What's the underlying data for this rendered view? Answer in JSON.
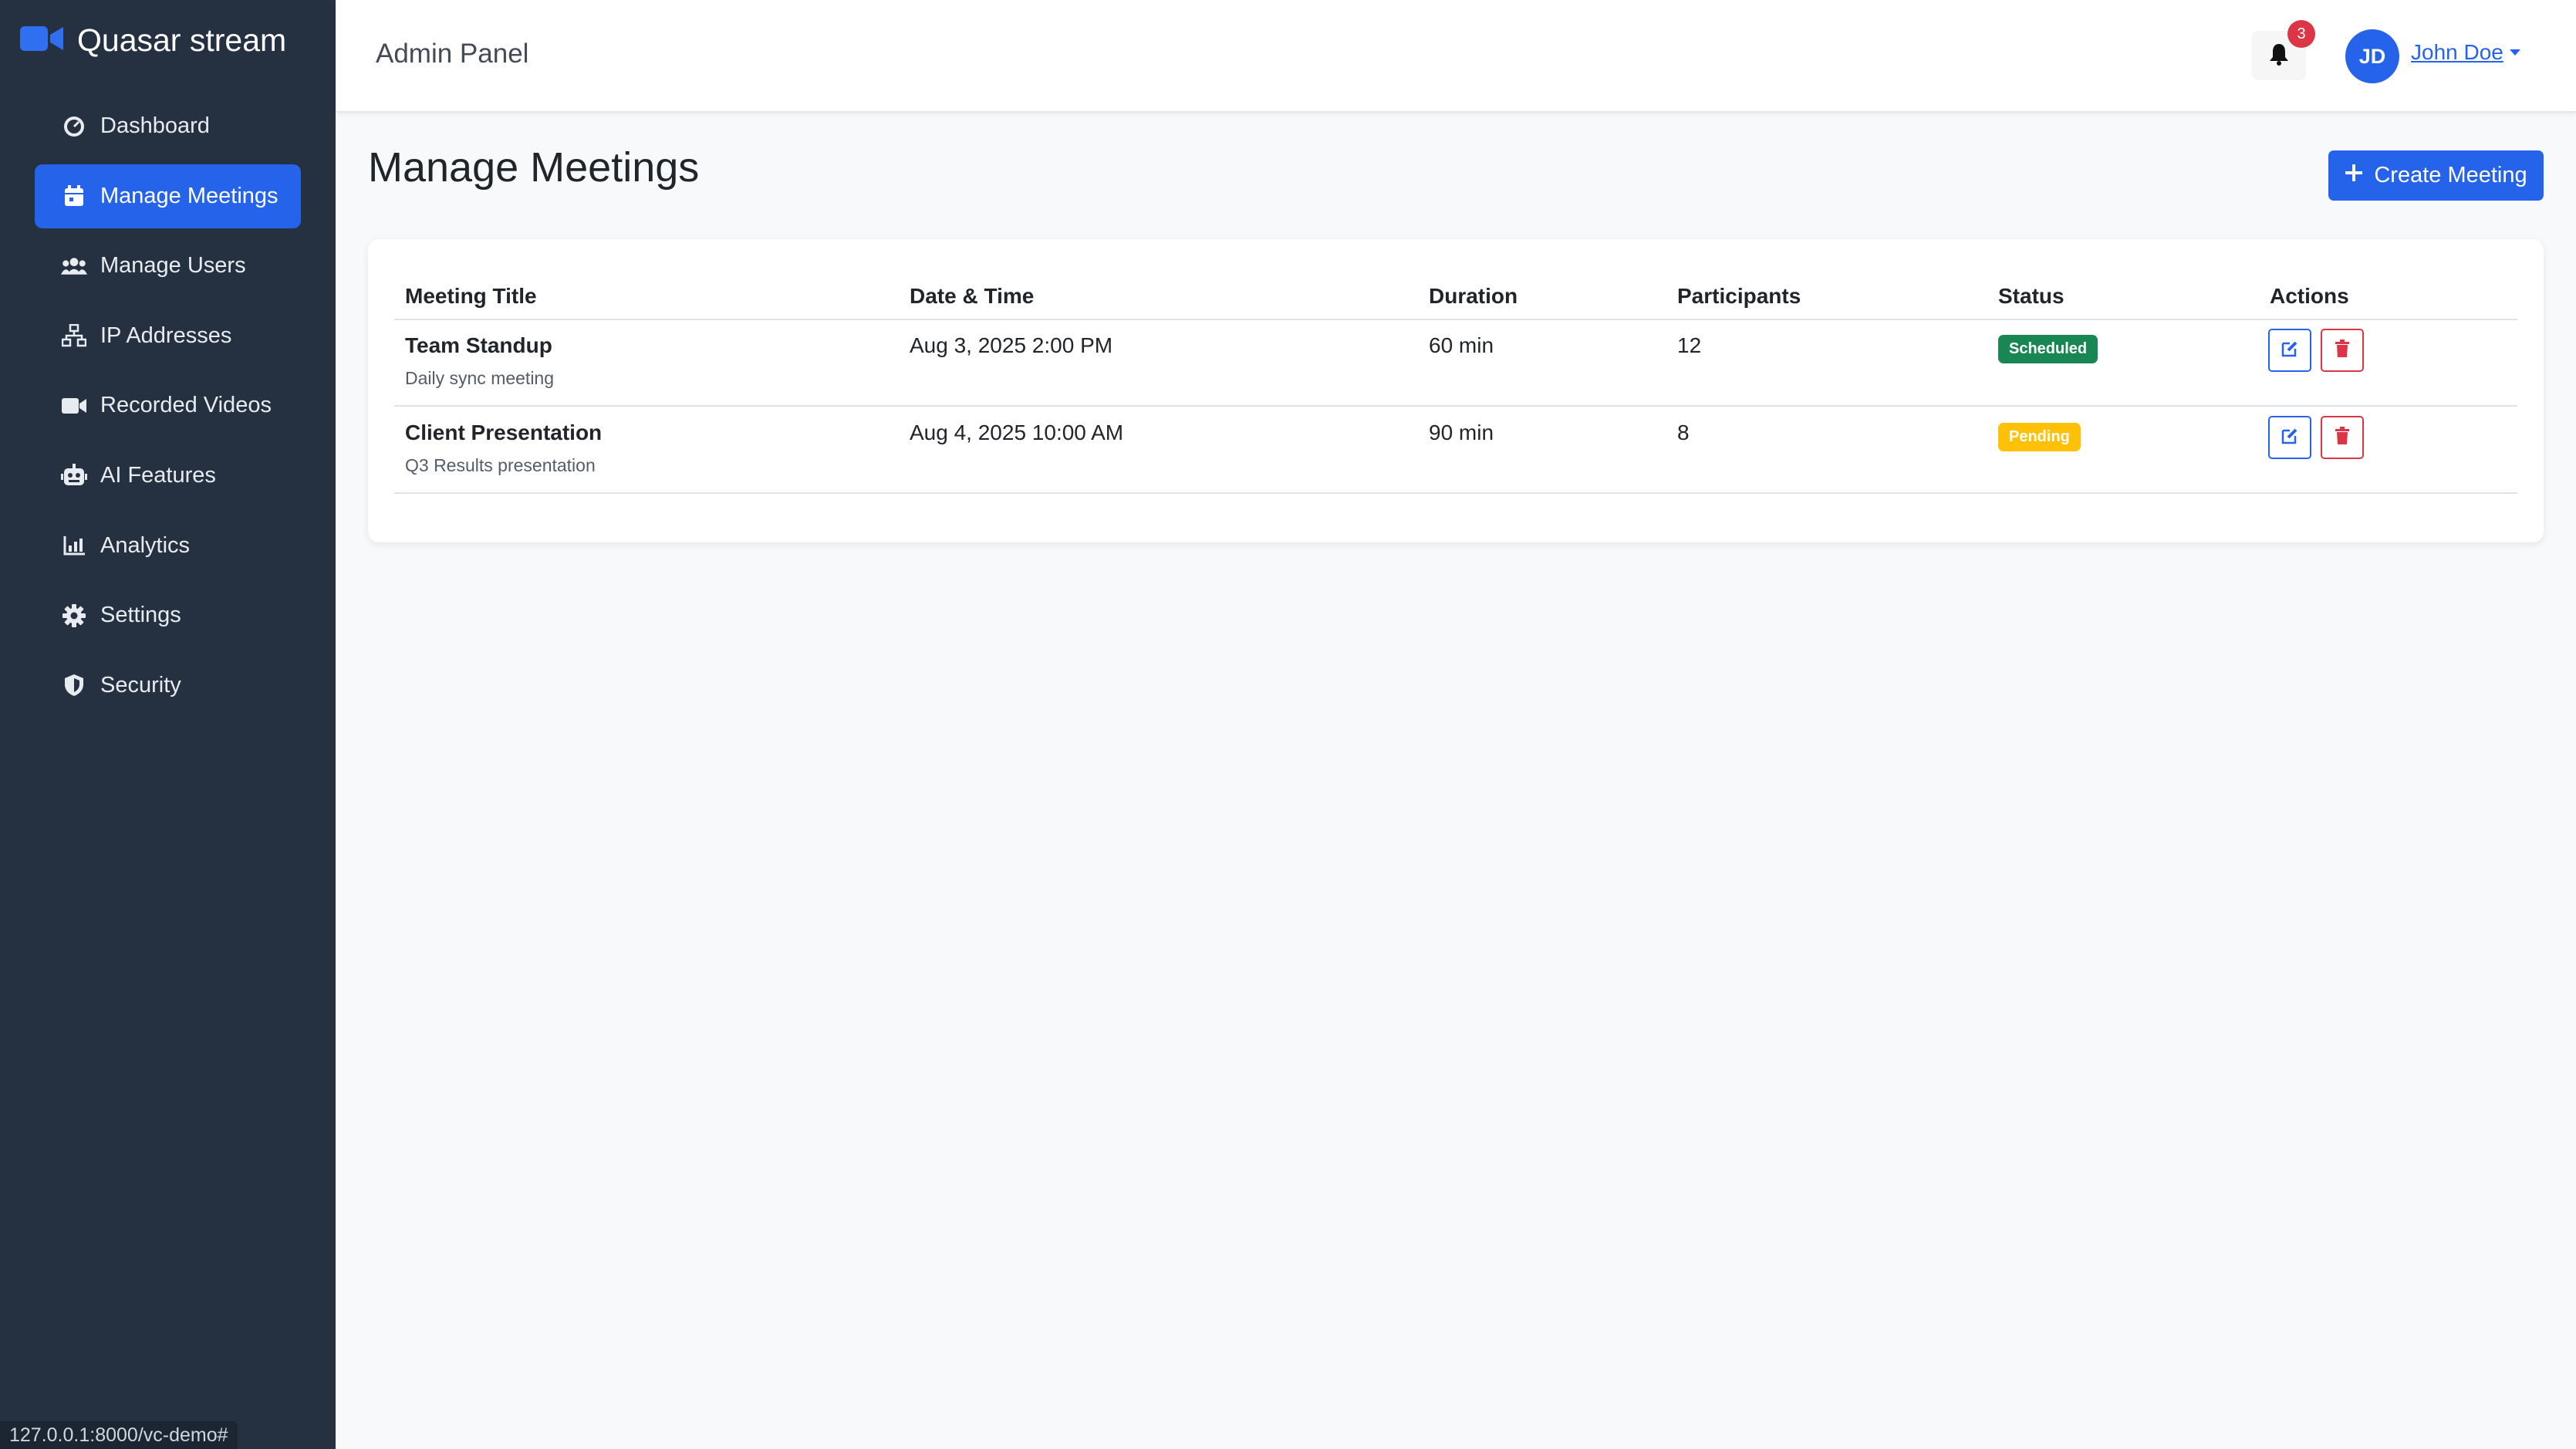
{
  "app": {
    "name": "Quasar stream",
    "topbar_title": "Admin Panel"
  },
  "colors": {
    "sidebar_bg": "#253041",
    "accent": "#2563eb",
    "danger": "#dc3545",
    "success": "#198754",
    "warning": "#ffc107"
  },
  "sidebar": {
    "items": [
      {
        "label": "Dashboard",
        "icon": "gauge-icon"
      },
      {
        "label": "Manage Meetings",
        "icon": "calendar-icon",
        "active": true
      },
      {
        "label": "Manage Users",
        "icon": "users-icon"
      },
      {
        "label": "IP Addresses",
        "icon": "network-icon"
      },
      {
        "label": "Recorded Videos",
        "icon": "video-icon"
      },
      {
        "label": "AI Features",
        "icon": "robot-icon"
      },
      {
        "label": "Analytics",
        "icon": "chart-line-icon"
      },
      {
        "label": "Settings",
        "icon": "gear-icon"
      },
      {
        "label": "Security",
        "icon": "shield-icon"
      }
    ]
  },
  "header": {
    "notifications_count": "3",
    "user_initials": "JD",
    "user_name": "John Doe"
  },
  "main": {
    "title": "Manage Meetings",
    "create_label": "Create Meeting",
    "table": {
      "columns": [
        "Meeting Title",
        "Date & Time",
        "Duration",
        "Participants",
        "Status",
        "Actions"
      ],
      "rows": [
        {
          "title": "Team Standup",
          "subtitle": "Daily sync meeting",
          "datetime": "Aug 3, 2025 2:00 PM",
          "duration": "60 min",
          "participants": "12",
          "status": "Scheduled"
        },
        {
          "title": "Client Presentation",
          "subtitle": "Q3 Results presentation",
          "datetime": "Aug 4, 2025 10:00 AM",
          "duration": "90 min",
          "participants": "8",
          "status": "Pending"
        }
      ]
    }
  },
  "status_bar": {
    "url": "127.0.0.1:8000/vc-demo#"
  }
}
